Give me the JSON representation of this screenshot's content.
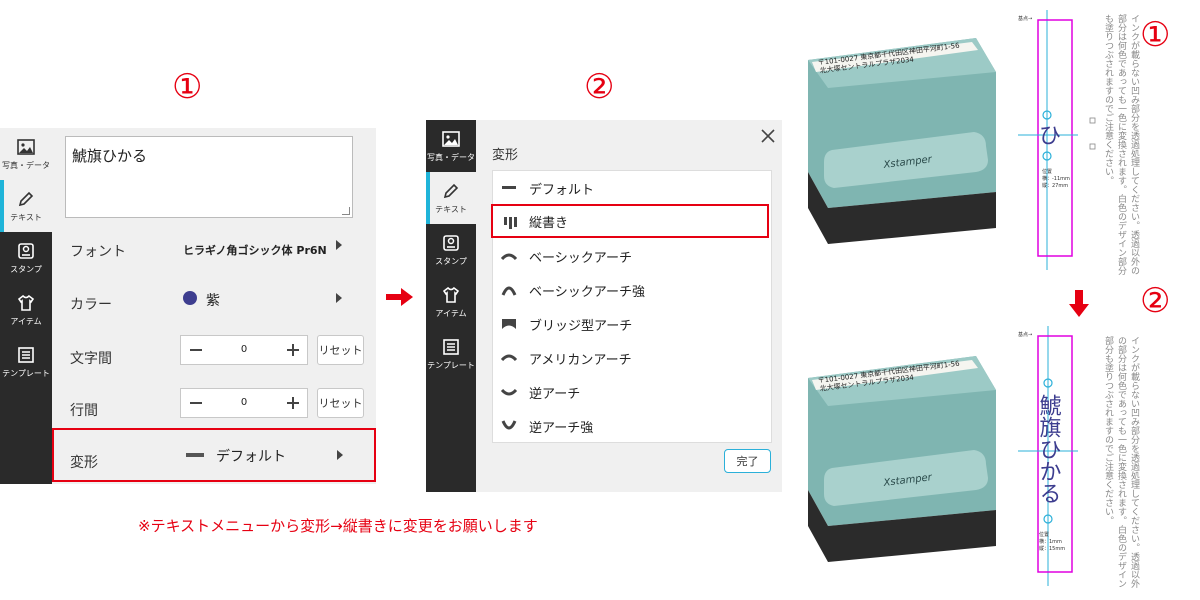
{
  "steps": {
    "step1": "①",
    "step2": "②",
    "step1_right": "①",
    "step2_right": "②"
  },
  "sidebar": {
    "items": [
      {
        "label": "写真・データ",
        "icon": "image-icon"
      },
      {
        "label": "テキスト",
        "icon": "pencil-icon"
      },
      {
        "label": "スタンプ",
        "icon": "stamp-icon"
      },
      {
        "label": "アイテム",
        "icon": "tshirt-icon"
      },
      {
        "label": "テンプレート",
        "icon": "template-icon"
      }
    ]
  },
  "panel1": {
    "text_value": "鯱旗ひかる",
    "font_label": "フォント",
    "font_value": "ヒラギノ角ゴシック体 Pr6N",
    "color_label": "カラー",
    "color_value": "紫",
    "color_hex": "#3d3d8f",
    "letter_spacing_label": "文字間",
    "letter_spacing_value": "0",
    "line_spacing_label": "行間",
    "line_spacing_value": "0",
    "reset_label": "リセット",
    "transform_label": "変形",
    "transform_value": "デフォルト"
  },
  "panel2": {
    "title": "変形",
    "options": [
      {
        "label": "デフォルト",
        "icon": "flat-line-icon"
      },
      {
        "label": "縦書き",
        "icon": "vertical-text-icon",
        "selected": true
      },
      {
        "label": "ベーシックアーチ",
        "icon": "arch-icon"
      },
      {
        "label": "ベーシックアーチ強",
        "icon": "strong-arch-icon"
      },
      {
        "label": "ブリッジ型アーチ",
        "icon": "bridge-arch-icon"
      },
      {
        "label": "アメリカンアーチ",
        "icon": "american-arch-icon"
      },
      {
        "label": "逆アーチ",
        "icon": "reverse-arch-icon"
      },
      {
        "label": "逆アーチ強",
        "icon": "strong-reverse-arch-icon"
      }
    ],
    "done_label": "完了"
  },
  "note": "※テキストメニューから変形→縦書きに変更をお願いします",
  "stamp": {
    "brand": "Xstamper",
    "address_line1": "〒101-0027 東京都千代田区神田平河町1-56",
    "address_line2": "北大塚セントラルプラザ2034",
    "preview1_text": "ひ",
    "preview2_text": "鯱旗ひかる",
    "base_point_label": "基点→",
    "position1": {
      "title": "位置",
      "h": "横：-11mm",
      "v": "縦：27mm"
    },
    "position2": {
      "title": "位置",
      "h": "横：1mm",
      "v": "縦：15mm"
    },
    "side_note": "インクが載らない凹み部分を透過処理してください。透過以外の部分は何色であっても一色に変換されます。白色のデザイン部分も塗りつぶされますのでご注意ください。"
  },
  "colors": {
    "accent_red": "#e60012",
    "accent_blue": "#1fb4d9",
    "guide_magenta": "#e000e0",
    "text_purple": "#3d3d8f"
  }
}
